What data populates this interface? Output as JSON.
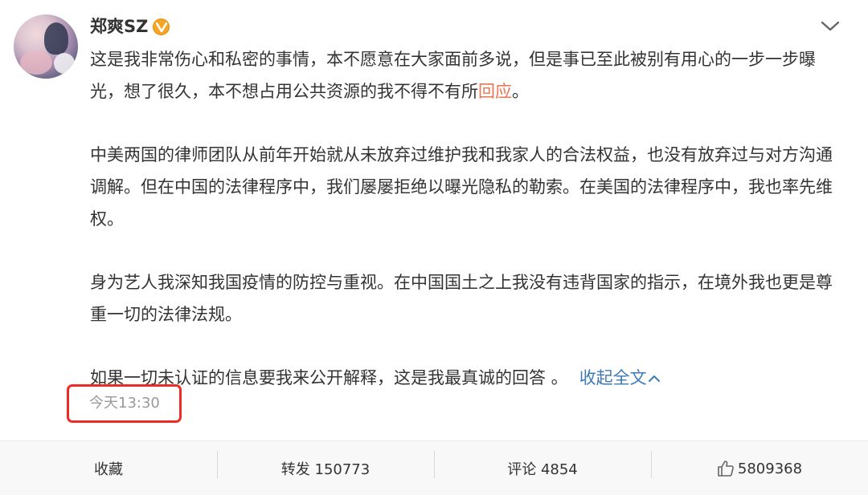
{
  "author": {
    "name": "郑爽SZ",
    "verified_badge": "v-verified-icon",
    "badge_color": "#f5a623"
  },
  "post": {
    "paragraphs": [
      {
        "text_before": "这是我非常伤心和私密的事情，本不愿意在大家面前多说，但是事已至此被别有用心的一步一步曝光，想了很久，本不想占用公共资源的我不得不有所",
        "link_text": "回应",
        "text_after": "。"
      },
      {
        "text": "中美两国的律师团队从前年开始就从未放弃过维护我和我家人的合法权益，也没有放弃过与对方沟通调解。但在中国的法律程序中，我们屡屡拒绝以曝光隐私的勒索。在美国的法律程序中，我也率先维权。"
      },
      {
        "text": "身为艺人我深知我国疫情的防控与重视。在中国国土之上我没有违背国家的指示，在境外我也更是尊重一切的法律法规。"
      },
      {
        "text": "如果一切未认证的信息要我来公开解释，这是我最真诚的回答 。"
      }
    ],
    "collapse_label": "收起全文",
    "timestamp": "今天13:30"
  },
  "actions": {
    "favorite": "收藏",
    "repost": "转发 150773",
    "comment": "评论 4854",
    "like": "5809368"
  },
  "colors": {
    "link_red": "#eb7350",
    "link_blue": "#3e7ab6",
    "highlight_box": "#ee2b24"
  }
}
